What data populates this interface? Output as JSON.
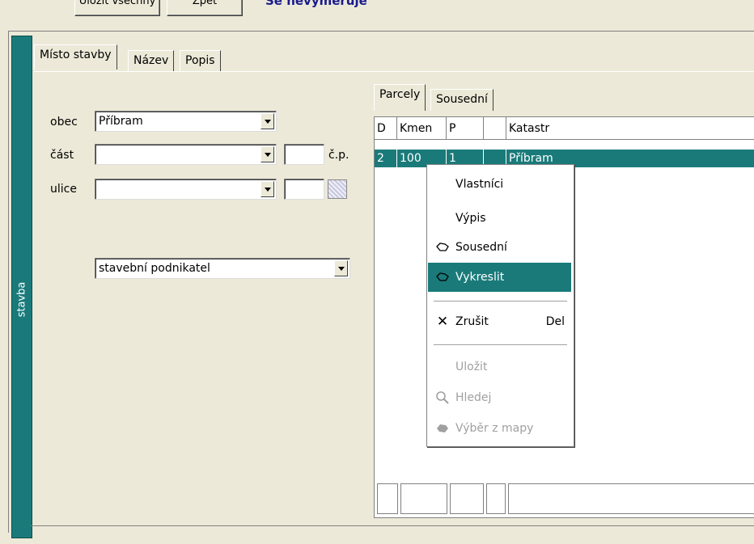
{
  "toolbar": {
    "btn1_label": "Uložit všechny",
    "btn2_label": "Zpět",
    "status_text": "Se nevyměřuje"
  },
  "sidebar": {
    "label": "stavba"
  },
  "tabs": [
    {
      "label": "Místo stavby",
      "active": true
    },
    {
      "label": "Název",
      "active": false
    },
    {
      "label": "Popis",
      "active": false
    }
  ],
  "form": {
    "obec_label": "obec",
    "obec_value": "Příbram",
    "cast_label": "část",
    "cast_value": "",
    "cp_label": "č.p.",
    "ulice_label": "ulice",
    "ulice_value": "",
    "role_value": "stavební podnikatel"
  },
  "sub_tabs": [
    {
      "label": "Parcely",
      "active": true
    },
    {
      "label": "Sousední",
      "active": false
    }
  ],
  "grid": {
    "columns": [
      "D",
      "Kmen",
      "P",
      "",
      "Katastr"
    ],
    "rows": [
      {
        "d": "2",
        "kmen": "100",
        "p": "1",
        "x": "",
        "katastr": "Příbram"
      }
    ]
  },
  "context_menu": {
    "items": [
      {
        "label": "Vlastníci",
        "icon": "",
        "shortcut": "",
        "enabled": true,
        "selected": false
      },
      {
        "label": "Výpis",
        "icon": "",
        "shortcut": "",
        "enabled": true,
        "selected": false
      },
      {
        "label": "Sousední",
        "icon": "parcel-outline-icon",
        "shortcut": "",
        "enabled": true,
        "selected": false
      },
      {
        "label": "Vykreslit",
        "icon": "parcel-outline-icon",
        "shortcut": "",
        "enabled": true,
        "selected": true
      },
      {
        "label": "Zrušit",
        "icon": "close-icon",
        "shortcut": "Del",
        "enabled": true,
        "selected": false
      },
      {
        "label": "Uložit",
        "icon": "",
        "shortcut": "",
        "enabled": false,
        "selected": false
      },
      {
        "label": "Hledej",
        "icon": "magnifier-icon",
        "shortcut": "",
        "enabled": false,
        "selected": false
      },
      {
        "label": "Výběr z mapy",
        "icon": "map-pick-icon",
        "shortcut": "",
        "enabled": false,
        "selected": false
      }
    ]
  },
  "colors": {
    "accent": "#1a7a7a",
    "background": "#ece9d8"
  }
}
